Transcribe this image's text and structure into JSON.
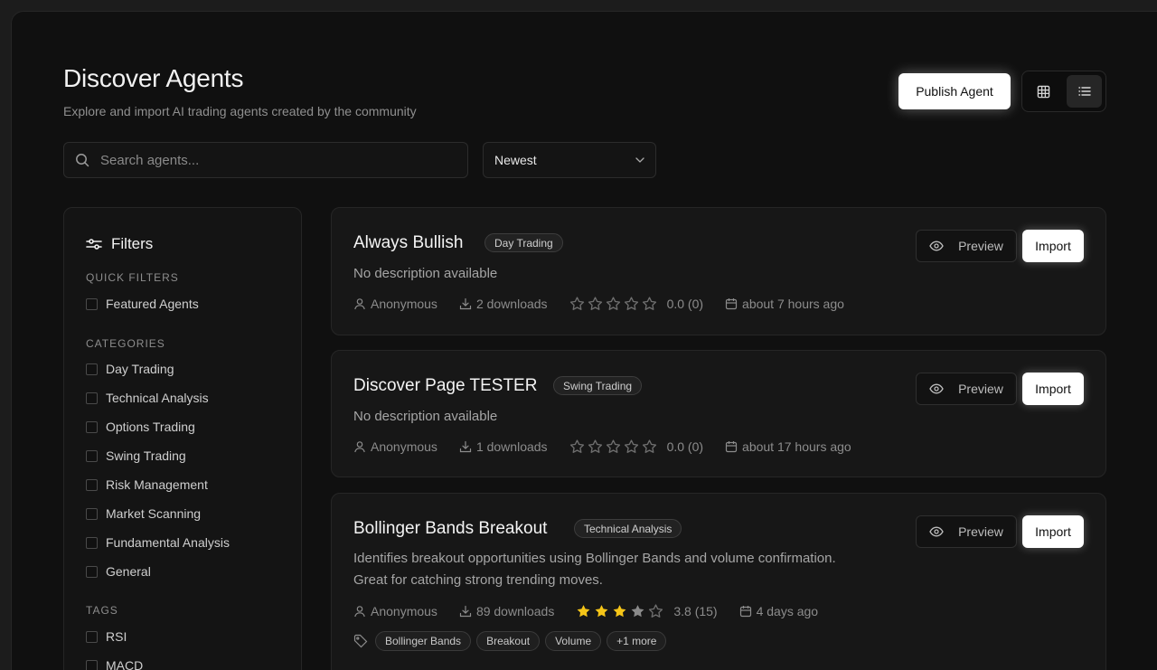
{
  "header": {
    "title": "Discover Agents",
    "subtitle": "Explore and import AI trading agents created by the community",
    "publish_label": "Publish Agent",
    "view_modes": [
      "grid-icon",
      "list-icon"
    ],
    "active_view": "list"
  },
  "search": {
    "placeholder": "Search agents...",
    "value": ""
  },
  "sort": {
    "selected": "Newest"
  },
  "filters": {
    "title": "Filters",
    "quick_label": "QUICK FILTERS",
    "quick": [
      "Featured Agents"
    ],
    "categories_label": "CATEGORIES",
    "categories": [
      "Day Trading",
      "Technical Analysis",
      "Options Trading",
      "Swing Trading",
      "Risk Management",
      "Market Scanning",
      "Fundamental Analysis",
      "General"
    ],
    "tags_label": "TAGS",
    "tags": [
      "RSI",
      "MACD"
    ]
  },
  "agents": [
    {
      "name": "Always Bullish",
      "category": "Day Trading",
      "description": [
        "No description available"
      ],
      "author": "Anonymous",
      "downloads": "2 downloads",
      "rating": 0,
      "rating_text": "0.0 (0)",
      "time": "about 7 hours ago",
      "preview_label": "Preview",
      "import_label": "Import"
    },
    {
      "name": "Discover Page TESTER",
      "category": "Swing Trading",
      "description": [
        "No description available"
      ],
      "author": "Anonymous",
      "downloads": "1 downloads",
      "rating": 0,
      "rating_text": "0.0 (0)",
      "time": "about 17 hours ago",
      "preview_label": "Preview",
      "import_label": "Import"
    },
    {
      "name": "Bollinger Bands Breakout",
      "category": "Technical Analysis",
      "description": [
        "Identifies breakout opportunities using Bollinger Bands and volume confirmation.",
        "Great for catching strong trending moves."
      ],
      "author": "Anonymous",
      "downloads": "89 downloads",
      "rating": 3,
      "rating_text": "3.8 (15)",
      "time": "4 days ago",
      "preview_label": "Preview",
      "import_label": "Import",
      "tags": [
        "Bollinger Bands",
        "Breakout",
        "Volume",
        "+1 more"
      ]
    }
  ],
  "colors": {
    "background": "#101010",
    "card": "#171717",
    "star_filled": "#f5c518",
    "star_empty": "#6e6e6e"
  }
}
